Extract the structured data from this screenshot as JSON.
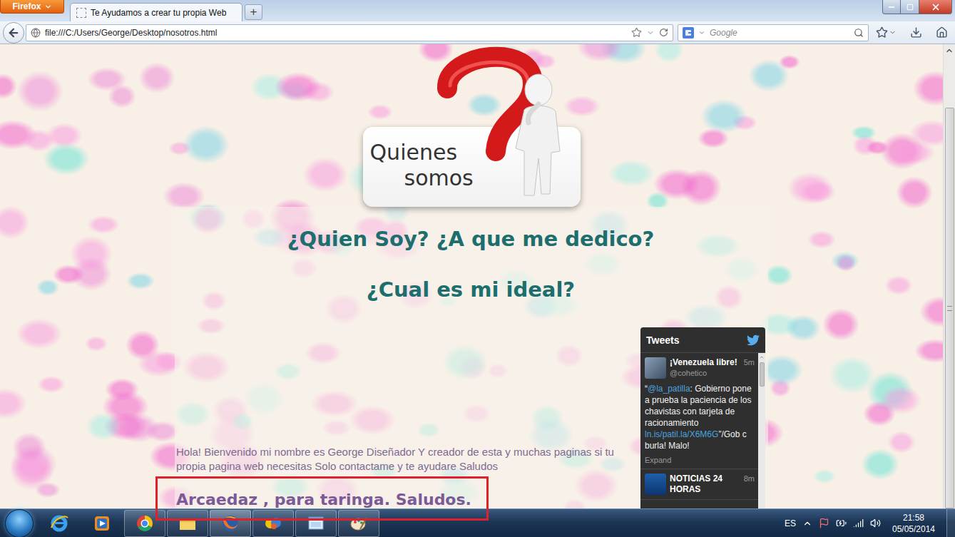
{
  "app_menu": {
    "label": "Firefox"
  },
  "tabs": [
    {
      "label": "Te Ayudamos a crear tu propia Web",
      "selected": true
    }
  ],
  "new_tab": {
    "label": "+"
  },
  "address_bar": {
    "url": "file:///C:/Users/George/Desktop/nosotros.html"
  },
  "search": {
    "placeholder": "Google"
  },
  "page": {
    "logo": {
      "lines": [
        "Quienes",
        "somos"
      ]
    },
    "headings": [
      "¿Quien Soy? ¿A que me dedico?",
      "¿Cual es mi ideal?"
    ],
    "intro": "Hola! Bienvenido mi nombre es George Diseñador Y creador de esta y muchas paginas si tu propia pagina web necesitas Solo contactame y te ayudare Saludos",
    "signature": {
      "text": "Arcaedaz , para taringa. Saludos.",
      "highlighted": true
    }
  },
  "twitter_widget": {
    "title": "Tweets",
    "tweets": [
      {
        "name": "¡Venezuela libre!",
        "handle": "@cohetico",
        "time": "5m",
        "text": [
          {
            "text": "“",
            "kind": "plain"
          },
          {
            "text": "@la_patilla",
            "kind": "link"
          },
          {
            "text": ": Gobierno pone a prueba la paciencia de los chavistas con tarjeta de racionamiento ",
            "kind": "plain"
          },
          {
            "text": "ln.is/patil.la/X6M6G",
            "kind": "link"
          },
          {
            "text": "”/Gob c burla! Malo!",
            "kind": "plain"
          }
        ],
        "action": "Expand"
      },
      {
        "name": "NOTICIAS 24 HORAS",
        "time": "8m"
      }
    ]
  },
  "taskbar": {
    "apps": [
      {
        "kind": "ie",
        "running": false,
        "active": false
      },
      {
        "kind": "media",
        "running": false,
        "active": false
      },
      {
        "kind": "chrome",
        "running": true,
        "active": false
      },
      {
        "kind": "folder",
        "running": true,
        "active": false
      },
      {
        "kind": "firefox",
        "running": true,
        "active": true
      },
      {
        "kind": "game",
        "running": true,
        "active": false
      },
      {
        "kind": "window",
        "running": true,
        "active": false
      },
      {
        "kind": "paint",
        "running": true,
        "active": false
      }
    ],
    "language": "ES",
    "time": "21:58",
    "date": "05/05/2014"
  }
}
